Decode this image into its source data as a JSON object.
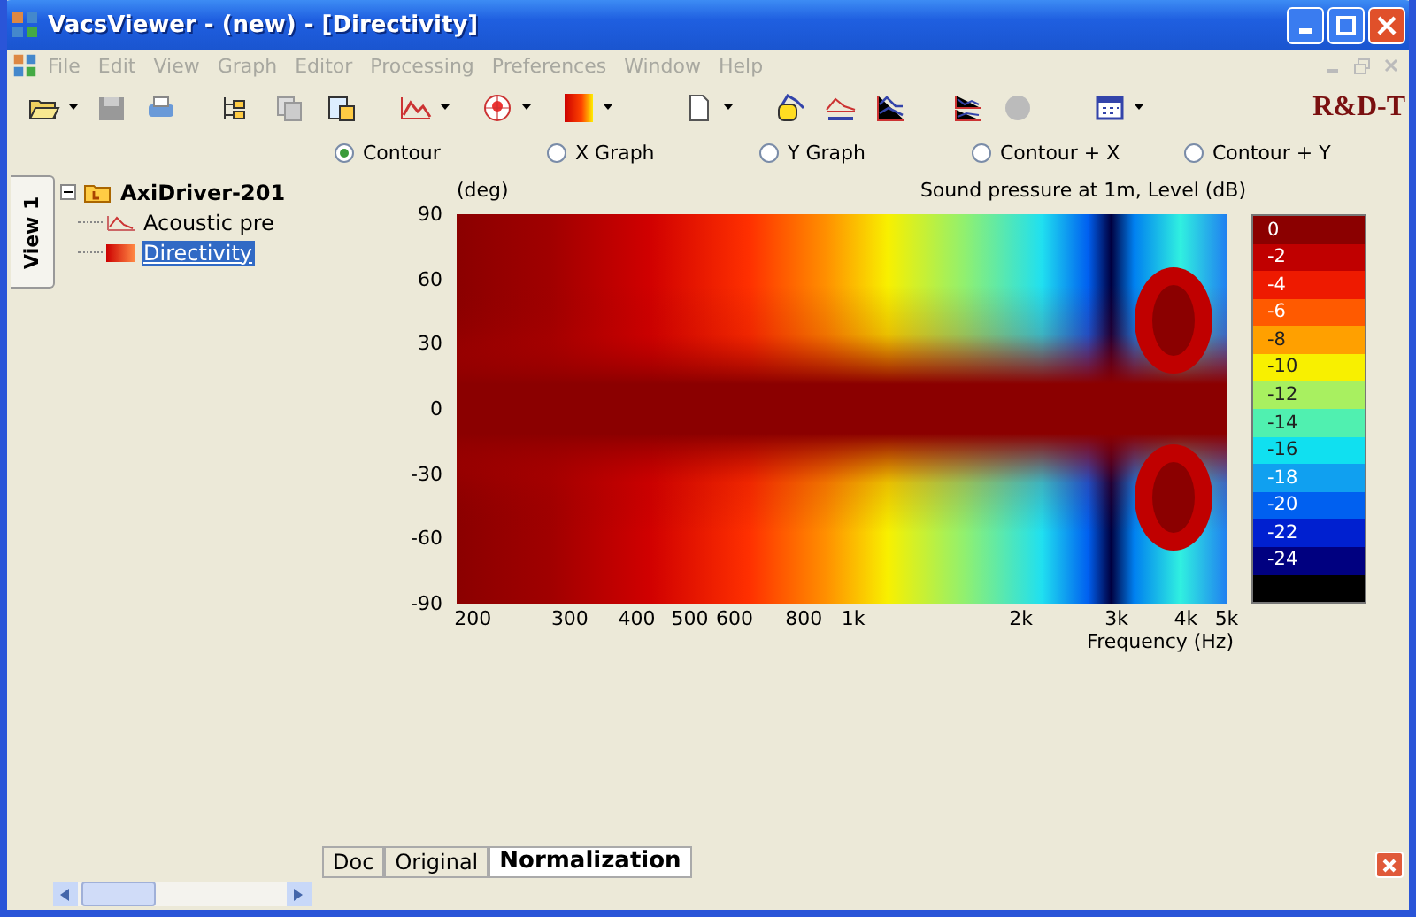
{
  "window": {
    "title": "VacsViewer - (new) - [Directivity]"
  },
  "menu": [
    "File",
    "Edit",
    "View",
    "Graph",
    "Editor",
    "Processing",
    "Preferences",
    "Window",
    "Help"
  ],
  "brand": "R&D-T",
  "view_options": [
    {
      "label": "Contour",
      "selected": true
    },
    {
      "label": "X Graph",
      "selected": false
    },
    {
      "label": "Y Graph",
      "selected": false
    },
    {
      "label": "Contour + X",
      "selected": false
    },
    {
      "label": "Contour + Y",
      "selected": false
    }
  ],
  "side_tab": {
    "label": "View 1"
  },
  "tree": {
    "label": "AxiDriver-201",
    "expanded": true,
    "children": [
      {
        "label": "Acoustic pre",
        "kind": "graph",
        "selected": false
      },
      {
        "label": "Directivity",
        "kind": "contour",
        "selected": true
      }
    ]
  },
  "chart": {
    "y_unit": "(deg)",
    "title": "Sound pressure at 1m, Level  (dB)",
    "xlabel": "Frequency  (Hz)",
    "yticks": [
      "90",
      "60",
      "30",
      "0",
      "-30",
      "-60",
      "-90"
    ],
    "xticks": [
      "200",
      "300",
      "400",
      "500",
      "600",
      "800",
      "1k",
      "2k",
      "3k",
      "4k",
      "5k"
    ],
    "legend": [
      {
        "label": "0",
        "color": "#8b0000"
      },
      {
        "label": "-2",
        "color": "#c00000"
      },
      {
        "label": "-4",
        "color": "#ee1a00"
      },
      {
        "label": "-6",
        "color": "#ff5a00"
      },
      {
        "label": "-8",
        "color": "#ffa000"
      },
      {
        "label": "-10",
        "color": "#f8f000"
      },
      {
        "label": "-12",
        "color": "#a8f060"
      },
      {
        "label": "-14",
        "color": "#50f0b0"
      },
      {
        "label": "-16",
        "color": "#10e0f0"
      },
      {
        "label": "-18",
        "color": "#10a0f0"
      },
      {
        "label": "-20",
        "color": "#0060f0"
      },
      {
        "label": "-22",
        "color": "#0020d0"
      },
      {
        "label": "-24",
        "color": "#000080"
      }
    ]
  },
  "bottom_tabs": [
    {
      "label": "Doc",
      "selected": false
    },
    {
      "label": "Original",
      "selected": false
    },
    {
      "label": "Normalization",
      "selected": true
    }
  ]
}
